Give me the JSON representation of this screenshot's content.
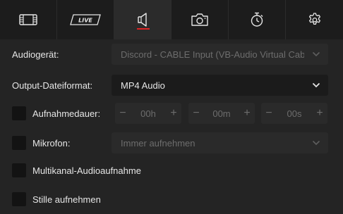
{
  "tabs": [
    {
      "id": "video",
      "icon": "film-icon",
      "label": ""
    },
    {
      "id": "live",
      "icon": "live-icon",
      "label": "LIVE"
    },
    {
      "id": "audio",
      "icon": "speaker-icon",
      "label": "",
      "active": true
    },
    {
      "id": "screenshot",
      "icon": "camera-icon",
      "label": ""
    },
    {
      "id": "timer",
      "icon": "stopwatch-icon",
      "label": ""
    },
    {
      "id": "settings",
      "icon": "gear-icon",
      "label": ""
    }
  ],
  "accent_color": "#e02424",
  "audio_device": {
    "label": "Audiogerät:",
    "value": "Discord - CABLE Input (VB-Audio Virtual Cable) ..."
  },
  "output_format": {
    "label": "Output-Dateiformat:",
    "value": "MP4 Audio"
  },
  "duration": {
    "label": "Aufnahmedauer:",
    "checked": false,
    "hours": "00h",
    "minutes": "00m",
    "seconds": "00s",
    "minus": "−",
    "plus": "+"
  },
  "microphone": {
    "label": "Mikrofon:",
    "checked": false,
    "value": "Immer aufnehmen"
  },
  "multichannel": {
    "label": "Multikanal-Audioaufnahme",
    "checked": false
  },
  "silence": {
    "label": "Stille aufnehmen",
    "checked": false
  }
}
